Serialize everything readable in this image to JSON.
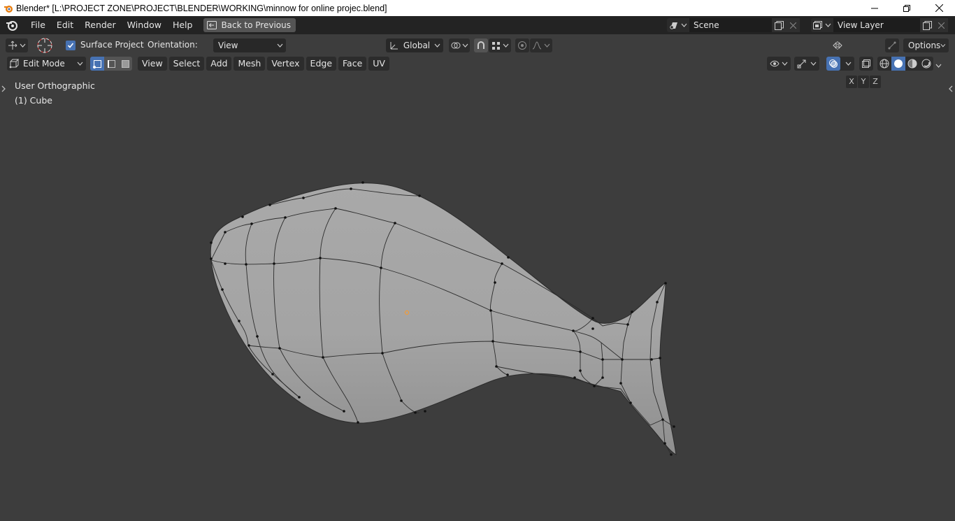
{
  "window": {
    "title": "Blender* [L:\\PROJECT ZONE\\PROJECT\\BLENDER\\WORKING\\minnow for online projec.blend]"
  },
  "topbar": {
    "menus": [
      "File",
      "Edit",
      "Render",
      "Window",
      "Help"
    ],
    "back_button": "Back to Previous",
    "scene_name": "Scene",
    "view_layer_name": "View Layer"
  },
  "tool_header": {
    "surface_project_label": "Surface Project",
    "surface_project_checked": true,
    "orientation_label": "Orientation:",
    "orientation_value": "View",
    "transform_orientation": "Global",
    "axis_labels": [
      "X",
      "Y",
      "Z"
    ],
    "options_label": "Options"
  },
  "mode_header": {
    "mode": "Edit Mode",
    "menus": [
      "View",
      "Select",
      "Add",
      "Mesh",
      "Vertex",
      "Edge",
      "Face",
      "UV"
    ]
  },
  "viewport": {
    "view_name": "User Orthographic",
    "object_name": "(1) Cube",
    "background_color": "#3d3d3d",
    "mesh_color": "#a6a6a6"
  },
  "colors": {
    "accent": "#4772b3",
    "header_bg": "#232323"
  }
}
